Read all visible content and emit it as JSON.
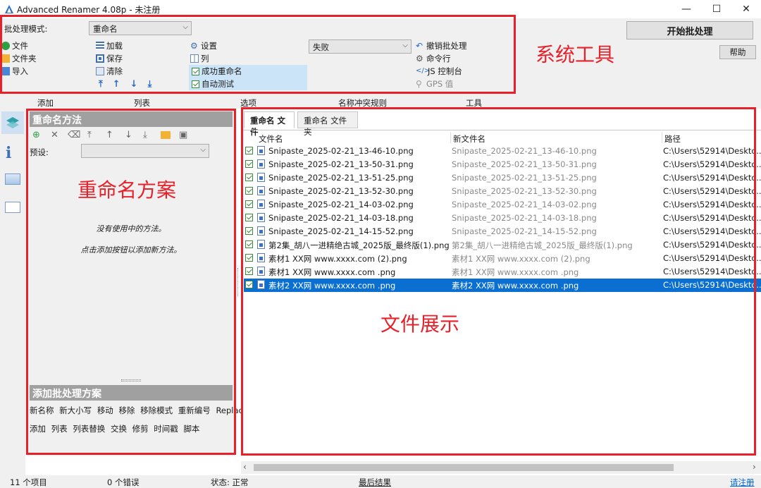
{
  "window": {
    "title": "Advanced Renamer 4.08p - 未注册",
    "minimize": "—",
    "maximize": "☐",
    "close": "✕"
  },
  "toolbar": {
    "batch_mode_label": "批处理模式:",
    "batch_mode_value": "重命名",
    "file": "文件",
    "folder": "文件夹",
    "import": "导入",
    "load": "加载",
    "save": "保存",
    "clear": "清除",
    "settings": "设置",
    "columns": "列",
    "success_rename": "成功重命名",
    "auto_test": "自动测试",
    "fail_select": "失败",
    "undo_batch": "撤销批处理",
    "command_line": "命令行",
    "js_console": "JS 控制台",
    "gps_value": "GPS 值",
    "start_batch": "开始批处理",
    "help": "帮助"
  },
  "sections": {
    "add": "添加",
    "list": "列表",
    "options": "选项",
    "conflict_rules": "名称冲突规则",
    "tools": "工具"
  },
  "methods_panel": {
    "header": "重命名方法",
    "preset_label": "预设:",
    "empty_line1": "没有使用中的方法。",
    "empty_line2": "点击添加按钮以添加新方法。",
    "add_header": "添加批处理方案",
    "methods_row1": [
      "新名称",
      "新大小写",
      "移动",
      "移除",
      "移除模式",
      "重新编号",
      "Replace"
    ],
    "methods_row2": [
      "添加",
      "列表",
      "列表替换",
      "交换",
      "修剪",
      "时间戳",
      "脚本"
    ]
  },
  "files_panel": {
    "tab_files": "重命名 文件",
    "tab_folders": "重命名 文件夹",
    "col_filename": "文件名",
    "col_newname": "新文件名",
    "col_path": "路径",
    "rows": [
      {
        "name": "Snipaste_2025-02-21_13-46-10.png",
        "new": "Snipaste_2025-02-21_13-46-10.png",
        "path": "C:\\Users\\52914\\Deskto..."
      },
      {
        "name": "Snipaste_2025-02-21_13-50-31.png",
        "new": "Snipaste_2025-02-21_13-50-31.png",
        "path": "C:\\Users\\52914\\Deskto..."
      },
      {
        "name": "Snipaste_2025-02-21_13-51-25.png",
        "new": "Snipaste_2025-02-21_13-51-25.png",
        "path": "C:\\Users\\52914\\Deskto..."
      },
      {
        "name": "Snipaste_2025-02-21_13-52-30.png",
        "new": "Snipaste_2025-02-21_13-52-30.png",
        "path": "C:\\Users\\52914\\Deskto..."
      },
      {
        "name": "Snipaste_2025-02-21_14-03-02.png",
        "new": "Snipaste_2025-02-21_14-03-02.png",
        "path": "C:\\Users\\52914\\Deskto..."
      },
      {
        "name": "Snipaste_2025-02-21_14-03-18.png",
        "new": "Snipaste_2025-02-21_14-03-18.png",
        "path": "C:\\Users\\52914\\Deskto..."
      },
      {
        "name": "Snipaste_2025-02-21_14-15-52.png",
        "new": "Snipaste_2025-02-21_14-15-52.png",
        "path": "C:\\Users\\52914\\Deskto..."
      },
      {
        "name": "第2集_胡八一进精绝古城_2025版_最终版(1).png",
        "new": "第2集_胡八一进精绝古城_2025版_最终版(1).png",
        "path": "C:\\Users\\52914\\Deskto..."
      },
      {
        "name": "素材1  XX网 www.xxxx.com (2).png",
        "new": "素材1  XX网 www.xxxx.com (2).png",
        "path": "C:\\Users\\52914\\Deskto..."
      },
      {
        "name": "素材1  XX网 www.xxxx.com .png",
        "new": "素材1  XX网 www.xxxx.com .png",
        "path": "C:\\Users\\52914\\Deskto..."
      },
      {
        "name": "素材2  XX网 www.xxxx.com .png",
        "new": "素材2  XX网 www.xxxx.com .png",
        "path": "C:\\Users\\52914\\Deskto...",
        "selected": true
      }
    ]
  },
  "annotations": {
    "system_tools": "系统工具",
    "rename_scheme": "重命名方案",
    "file_display": "文件展示"
  },
  "statusbar": {
    "item_count": "11  个项目",
    "error_count": "0  个错误",
    "status": "状态: 正常",
    "last_result": "最后结果",
    "register": "请注册"
  },
  "colors": {
    "annotation_red": "#e8202a",
    "selection_blue": "#0a6fd0",
    "link_blue": "#0066cc"
  }
}
